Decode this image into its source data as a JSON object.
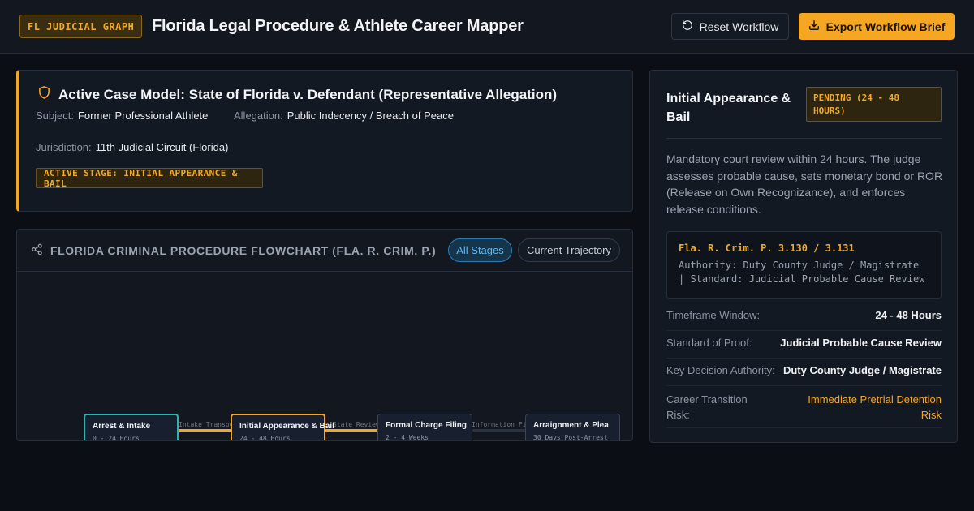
{
  "header": {
    "brand_badge": "FL JUDICIAL GRAPH",
    "title": "Florida Legal Procedure & Athlete Career Mapper",
    "reset_label": "Reset Workflow",
    "export_label": "Export Workflow Brief"
  },
  "case": {
    "title": "Active Case Model: State of Florida v. Defendant (Representative Allegation)",
    "subject_key": "Subject:",
    "subject_value": "Former Professional Athlete",
    "allegation_key": "Allegation:",
    "allegation_value": "Public Indecency / Breach of Peace",
    "jurisdiction_key": "Jurisdiction:",
    "jurisdiction_value": "11th Judicial Circuit (Florida)",
    "stage_badge": "ACTIVE STAGE: INITIAL APPEARANCE & BAIL"
  },
  "flowchart": {
    "title": "FLORIDA CRIMINAL PROCEDURE FLOWCHART (FLA. R. CRIM. P.)",
    "filter_all": "All Stages",
    "filter_current": "Current Trajectory",
    "nodes": [
      {
        "title": "Arrest & Intake",
        "time": "0 - 24 Hours",
        "state": "done"
      },
      {
        "title": "Initial Appearance & Bail",
        "time": "24 - 48 Hours",
        "state": "active"
      },
      {
        "title": "Formal Charge Filing",
        "time": "2 - 4 Weeks",
        "state": "pending"
      },
      {
        "title": "Arraignment & Plea",
        "time": "30 Days Post-Arrest",
        "state": "pending"
      }
    ],
    "edges": [
      {
        "label": "Intake Transport",
        "color": "#f5a623"
      },
      {
        "label": "State Review",
        "color": "#f5a623"
      },
      {
        "label": "Information Filed",
        "color": "#2a3344"
      }
    ]
  },
  "detail": {
    "title": "Initial Appearance & Bail",
    "status": "PENDING (24 - 48 HOURS)",
    "description": "Mandatory court review within 24 hours. The judge assesses probable cause, sets monetary bond or ROR (Release on Own Recognizance), and enforces release conditions.",
    "rule_citation": "Fla. R. Crim. P. 3.130 / 3.131",
    "rule_detail": "Authority: Duty County Judge / Magistrate | Standard: Judicial Probable Cause Review",
    "rows": [
      {
        "key": "Timeframe Window:",
        "value": "24 - 48 Hours"
      },
      {
        "key": "Standard of Proof:",
        "value": "Judicial Probable Cause Review"
      },
      {
        "key": "Key Decision Authority:",
        "value": "Duty County Judge / Magistrate"
      },
      {
        "key": "Career Transition Risk:",
        "value": "Immediate Pretrial Detention Risk"
      }
    ]
  },
  "colors": {
    "accent": "#f5a623",
    "teal": "#2ab5b0",
    "blue": "#5fb8f0"
  }
}
